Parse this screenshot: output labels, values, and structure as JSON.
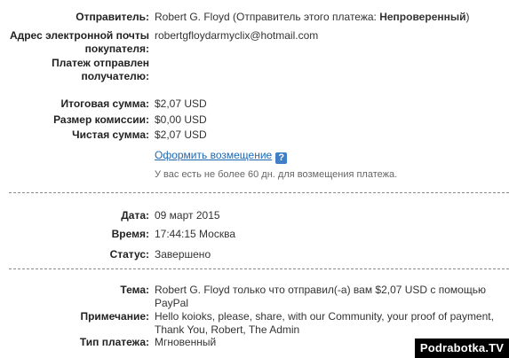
{
  "sender": {
    "label": "Отправитель:",
    "name": "Robert G. Floyd",
    "status_prefix": "(Отправитель этого платежа: ",
    "status_value": "Непроверенный",
    "status_suffix": ")"
  },
  "buyer_email": {
    "label_line1": "Адрес электронной почты",
    "label_line2": "покупателя:",
    "value": "robertgfloydarmyclix@hotmail.com"
  },
  "sent_to": {
    "label_line1": "Платеж отправлен",
    "label_line2": "получателю:"
  },
  "amounts": {
    "total_label": "Итоговая сумма:",
    "total_value": "$2,07 USD",
    "fee_label": "Размер комиссии:",
    "fee_value": "$0,00 USD",
    "net_label": "Чистая сумма:",
    "net_value": "$2,07 USD"
  },
  "refund": {
    "link_text": "Оформить возмещение",
    "help_icon": "question-icon",
    "help_glyph": "?",
    "note": "У вас есть не более 60 дн. для возмещения платежа."
  },
  "details": {
    "date_label": "Дата:",
    "date_value": "09 март 2015",
    "time_label": "Время:",
    "time_value": "17:44:15 Москва",
    "status_label": "Статус:",
    "status_value": "Завершено"
  },
  "message": {
    "subject_label": "Тема:",
    "subject_value": "Robert G. Floyd только что отправил(-а) вам $2,07 USD с помощью PayPal",
    "note_label": "Примечание:",
    "note_value": "Hello koioks, please, share, with our Community, your proof of payment, Thank You, Robert, The Admin",
    "type_label": "Тип платежа:",
    "type_value": "Мгновенный"
  },
  "watermark": "Podrabotka.TV",
  "colors": {
    "link": "#1d67b3",
    "help_icon": "#3f7fc6",
    "separator": "#8a8a8a"
  }
}
